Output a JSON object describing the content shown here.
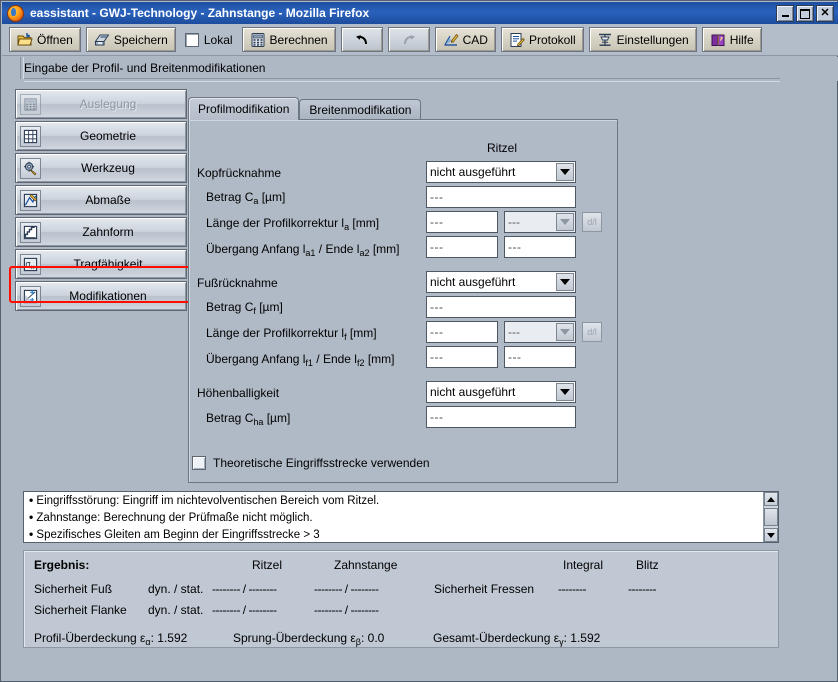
{
  "window": {
    "title": "eassistant - GWJ-Technology - Zahnstange - Mozilla Firefox",
    "minimize_label": "Minimize",
    "maximize_label": "Maximize",
    "close_label": "Close"
  },
  "toolbar": {
    "open": "Öffnen",
    "save": "Speichern",
    "local": "Lokal",
    "calculate": "Berechnen",
    "undo": "",
    "redo": "",
    "cad": "CAD",
    "protocol": "Protokoll",
    "settings": "Einstellungen",
    "help": "Hilfe"
  },
  "header": {
    "caption": "Eingabe der Profil- und Breitenmodifikationen"
  },
  "sidebar": {
    "items": [
      {
        "label": "Auslegung",
        "icon": "calculator-icon",
        "enabled": false
      },
      {
        "label": "Geometrie",
        "icon": "grid-icon",
        "enabled": true
      },
      {
        "label": "Werkzeug",
        "icon": "gear-tool-icon",
        "enabled": true
      },
      {
        "label": "Abmaße",
        "icon": "ruler-chart-icon",
        "enabled": true
      },
      {
        "label": "Zahnform",
        "icon": "tooth-profile-icon",
        "enabled": true
      },
      {
        "label": "Tragfähigkeit",
        "icon": "sigma-x-icon",
        "enabled": true
      },
      {
        "label": "Modifikationen",
        "icon": "modification-icon",
        "enabled": true
      }
    ],
    "highlight_color": "#f01b10",
    "highlighted_item": "Modifikationen"
  },
  "tabs": [
    {
      "label": "Profilmodifikation",
      "active": true
    },
    {
      "label": "Breitenmodifikation",
      "active": false
    }
  ],
  "form": {
    "column_header": "Ritzel",
    "groups": [
      {
        "title": "Kopfrücknahme",
        "select_value": "nicht ausgeführt",
        "rows": [
          {
            "label_pre": "Betrag C",
            "label_sub": "a",
            "label_post": " [µm]",
            "value1": "---",
            "type": "wide"
          },
          {
            "label_pre": "Länge der Profilkorrektur l",
            "label_sub": "a",
            "label_post": " [mm]",
            "value1": "---",
            "value2": "---",
            "type": "split-combo",
            "mini": "d/l"
          },
          {
            "label_pre": "Übergang Anfang l",
            "label_sub": "a1",
            "label_mid": " / Ende l",
            "label_sub2": "a2",
            "label_post": " [mm]",
            "value1": "---",
            "value2": "---",
            "type": "split"
          }
        ]
      },
      {
        "title": "Fußrücknahme",
        "select_value": "nicht ausgeführt",
        "rows": [
          {
            "label_pre": "Betrag C",
            "label_sub": "f",
            "label_post": " [µm]",
            "value1": "---",
            "type": "wide"
          },
          {
            "label_pre": "Länge der Profilkorrektur l",
            "label_sub": "f",
            "label_post": " [mm]",
            "value1": "---",
            "value2": "---",
            "type": "split-combo",
            "mini": "d/l"
          },
          {
            "label_pre": "Übergang Anfang l",
            "label_sub": "f1",
            "label_mid": " / Ende l",
            "label_sub2": "f2",
            "label_post": " [mm]",
            "value1": "---",
            "value2": "---",
            "type": "split"
          }
        ]
      },
      {
        "title": "Höhenballigkeit",
        "select_value": "nicht ausgeführt",
        "rows": [
          {
            "label_pre": "Betrag C",
            "label_sub": "ha",
            "label_post": " [µm]",
            "value1": "---",
            "type": "wide"
          }
        ]
      }
    ],
    "checkbox": {
      "label": "Theoretische Eingriffsstrecke verwenden",
      "checked": false
    }
  },
  "messages": [
    "Eingriffsstörung: Eingriff im nichtevolventischen Bereich vom Ritzel.",
    "Zahnstange: Berechnung der Prüfmaße nicht möglich.",
    "Spezifisches Gleiten am Beginn der Eingriffsstrecke > 3"
  ],
  "results": {
    "title": "Ergebnis:",
    "col_ritzel": "Ritzel",
    "col_zahnstange": "Zahnstange",
    "col_integral": "Integral",
    "col_blitz": "Blitz",
    "rows": [
      {
        "label": "Sicherheit Fuß",
        "mode": "dyn. / stat.",
        "ritzel": "-------- / --------",
        "zahnstange": "-------- / --------"
      },
      {
        "label": "Sicherheit Flanke",
        "mode": "dyn. / stat.",
        "ritzel": "-------- / --------",
        "zahnstange": "-------- / --------"
      }
    ],
    "fressen": {
      "label": "Sicherheit Fressen",
      "integral": "--------",
      "blitz": "--------"
    },
    "overlaps": [
      {
        "label_pre": "Profil-Überdeckung ε",
        "sub": "α",
        "label_post": ":",
        "value": "1.592"
      },
      {
        "label_pre": "Sprung-Überdeckung ε",
        "sub": "β",
        "label_post": ":",
        "value": "0.0"
      },
      {
        "label_pre": "Gesamt-Überdeckung ε",
        "sub": "γ",
        "label_post": ":",
        "value": "1.592"
      }
    ]
  },
  "colors": {
    "titlebar": "#2a62bd",
    "panel_bg": "#aeb8c4",
    "toolbar_bg": "#b3bdc9",
    "annotation": "#f01b10"
  }
}
